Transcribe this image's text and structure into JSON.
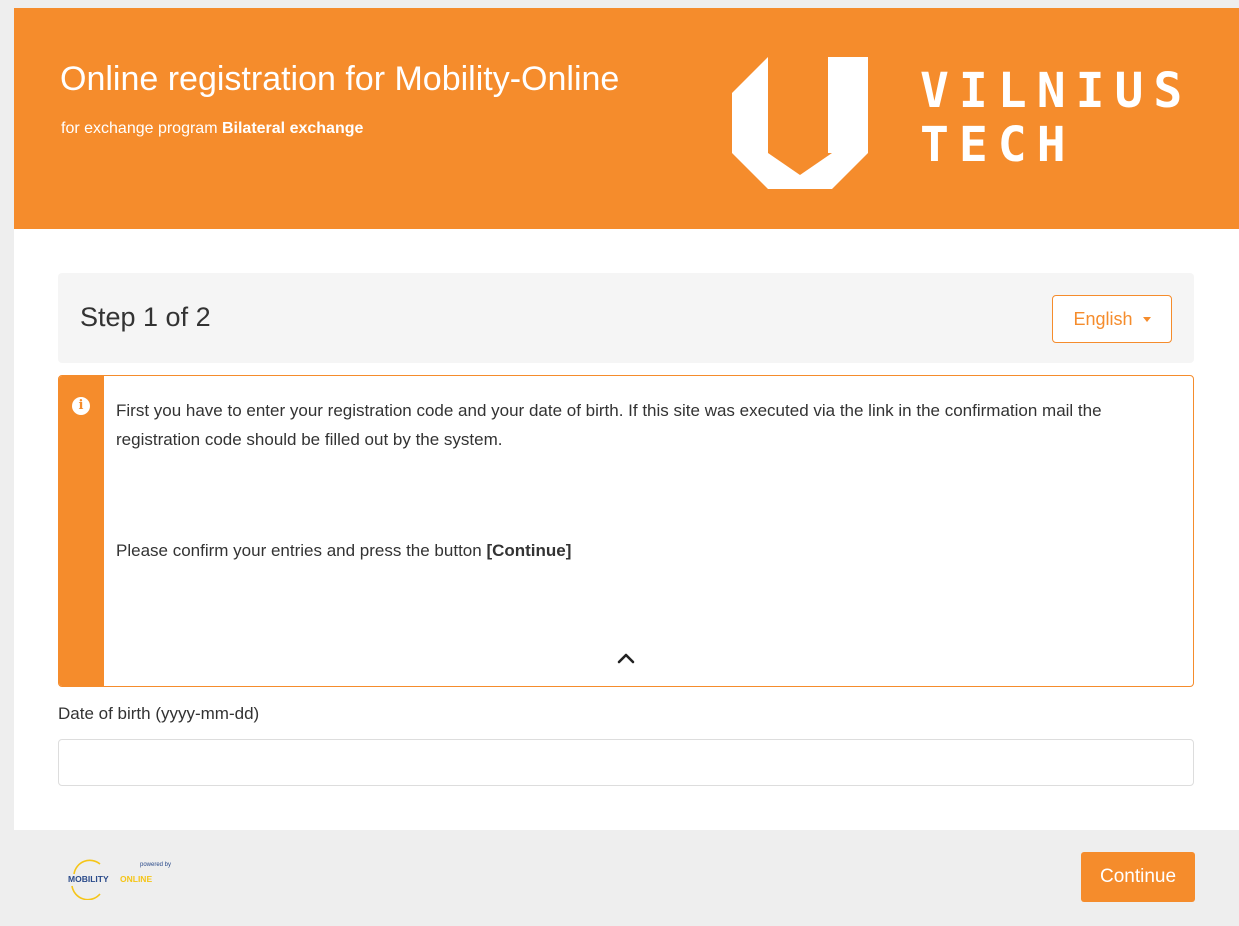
{
  "header": {
    "title": "Online registration for Mobility-Online",
    "subtitle_prefix": "for exchange program ",
    "subtitle_program": "Bilateral exchange",
    "logo_line1": "VILNIUS",
    "logo_line2": "TECH"
  },
  "step": {
    "title": "Step 1 of 2",
    "language": "English"
  },
  "info": {
    "text1": "First you have to enter your registration code and your date of birth. If this site was executed via the link in the confirmation mail the registration code should be filled out by the system.",
    "text2_prefix": "Please confirm your entries and press the button ",
    "text2_bold": "[Continue]"
  },
  "form": {
    "dob_label": "Date of birth (yyyy-mm-dd)",
    "dob_value": ""
  },
  "footer": {
    "powered_by": "powered by",
    "brand_left": "MOBILITY",
    "brand_right": "ONLINE",
    "continue_label": "Continue"
  },
  "colors": {
    "accent": "#f58c2c",
    "panel": "#f5f5f5",
    "footer": "#eeeeee"
  }
}
